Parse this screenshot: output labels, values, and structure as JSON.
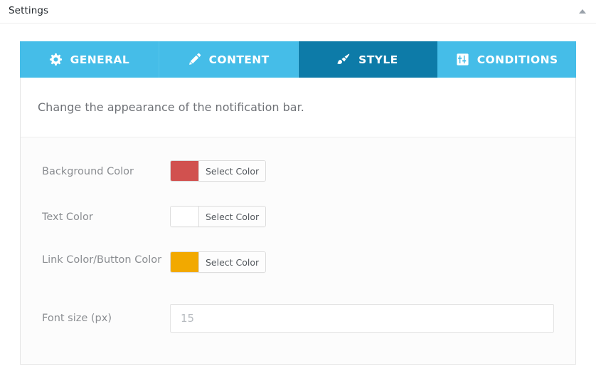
{
  "window": {
    "title": "Settings",
    "collapse_icon": "caret-up-icon"
  },
  "tabs": [
    {
      "id": "general",
      "label": "GENERAL",
      "icon": "gear-icon",
      "active": false
    },
    {
      "id": "content",
      "label": "CONTENT",
      "icon": "pencil-icon",
      "active": false
    },
    {
      "id": "style",
      "label": "STYLE",
      "icon": "paint-brush-icon",
      "active": true
    },
    {
      "id": "conditions",
      "label": "CONDITIONS",
      "icon": "sliders-icon",
      "active": false
    }
  ],
  "panel": {
    "description": "Change the appearance of the notification bar."
  },
  "fields": [
    {
      "id": "background-color",
      "label": "Background Color",
      "type": "color",
      "swatch_color": "#d1514f",
      "button_label": "Select Color"
    },
    {
      "id": "text-color",
      "label": "Text Color",
      "type": "color",
      "swatch_color": "#ffffff",
      "button_label": "Select Color"
    },
    {
      "id": "link-button-color",
      "label": "Link Color/Button Color",
      "type": "color",
      "swatch_color": "#f2a900",
      "button_label": "Select Color"
    },
    {
      "id": "font-size",
      "label": "Font size (px)",
      "type": "text",
      "value": "",
      "placeholder": "15"
    }
  ],
  "colors": {
    "tab_inactive": "#45bde8",
    "tab_active": "#0d7ba8",
    "panel_background": "#fcfcfc",
    "label_text": "#8a8d91"
  }
}
